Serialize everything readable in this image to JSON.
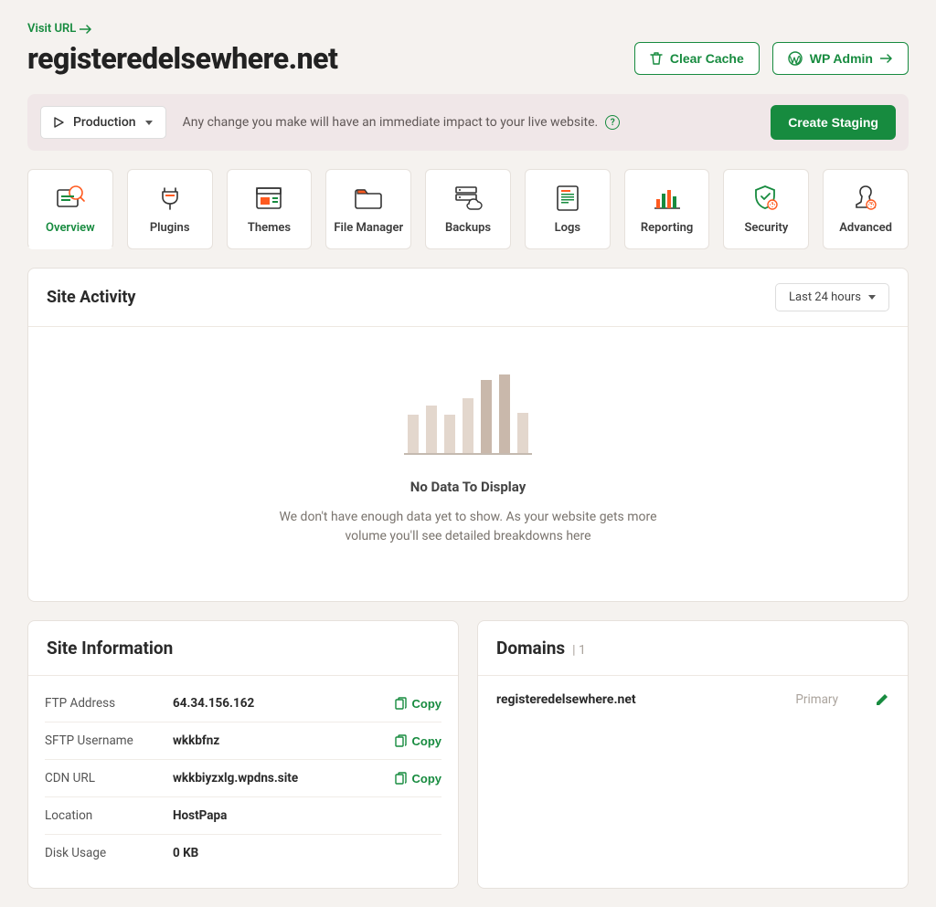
{
  "header": {
    "visit_url_label": "Visit URL",
    "site_title": "registeredelsewhere.net",
    "clear_cache_label": "Clear Cache",
    "wp_admin_label": "WP Admin"
  },
  "env_bar": {
    "selected_env": "Production",
    "message": "Any change you make will have an immediate impact to your live website.",
    "create_staging_label": "Create Staging"
  },
  "tabs": [
    {
      "id": "overview",
      "label": "Overview",
      "active": true
    },
    {
      "id": "plugins",
      "label": "Plugins"
    },
    {
      "id": "themes",
      "label": "Themes"
    },
    {
      "id": "file-manager",
      "label": "File Manager"
    },
    {
      "id": "backups",
      "label": "Backups"
    },
    {
      "id": "logs",
      "label": "Logs"
    },
    {
      "id": "reporting",
      "label": "Reporting"
    },
    {
      "id": "security",
      "label": "Security"
    },
    {
      "id": "advanced",
      "label": "Advanced"
    }
  ],
  "activity": {
    "title": "Site Activity",
    "range_label": "Last 24 hours",
    "nodata_title": "No Data To Display",
    "nodata_sub": "We don't have enough data yet to show. As your website gets more volume you'll see detailed breakdowns here"
  },
  "site_info": {
    "title": "Site Information",
    "rows": [
      {
        "label": "FTP Address",
        "value": "64.34.156.162",
        "copy": true
      },
      {
        "label": "SFTP Username",
        "value": "wkkbfnz",
        "copy": true
      },
      {
        "label": "CDN URL",
        "value": "wkkbiyzxlg.wpdns.site",
        "copy": true
      },
      {
        "label": "Location",
        "value": "HostPapa",
        "copy": false
      },
      {
        "label": "Disk Usage",
        "value": "0 KB",
        "copy": false
      }
    ],
    "copy_label": "Copy"
  },
  "domains": {
    "title": "Domains",
    "count": "| 1",
    "items": [
      {
        "name": "registeredelsewhere.net",
        "tag": "Primary"
      }
    ]
  }
}
